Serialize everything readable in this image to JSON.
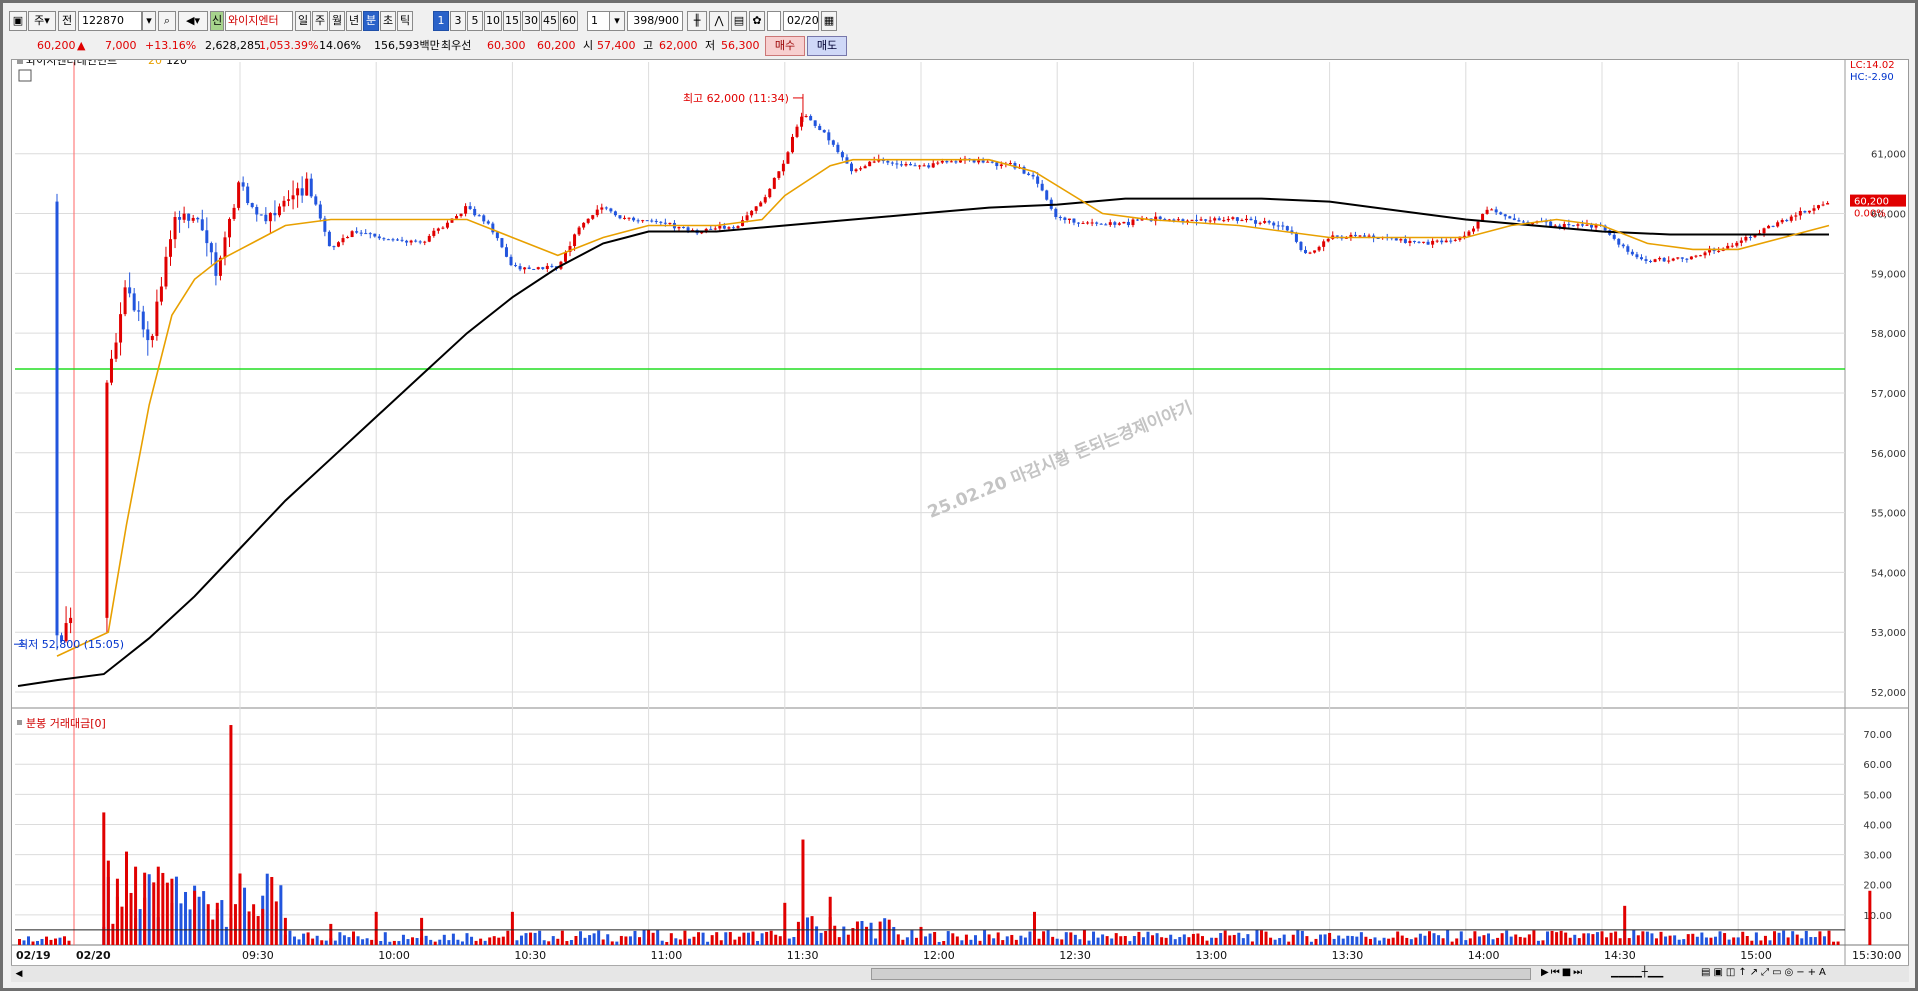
{
  "toolbar": {
    "market_select": "주",
    "prev_label": "전",
    "stock_code": "122870",
    "badge": "신",
    "stock_name": "와이지엔터",
    "period_tabs": [
      "일",
      "주",
      "월",
      "년",
      "분",
      "초",
      "틱"
    ],
    "active_period": "분",
    "interval_buttons": [
      "1",
      "3",
      "5",
      "10",
      "15",
      "30",
      "45",
      "60"
    ],
    "active_interval": "1",
    "interval_select": "1",
    "count_display": "398/900",
    "date_value": "02/20"
  },
  "infobar": {
    "price": "60,200",
    "change_arrow": "▲",
    "change": "7,000",
    "change_pct": "+13.16%",
    "volume": "2,628,285",
    "volume_ratio": "1,053.39%",
    "turnover": "14.06%",
    "amount": "156,593백만",
    "best_label": "최우선",
    "best_ask": "60,300",
    "best_bid": "60,200",
    "open_label": "시",
    "open": "57,400",
    "high_label": "고",
    "high": "62,000",
    "low_label": "저",
    "low": "56,300",
    "buy_button": "매수",
    "sell_button": "매도"
  },
  "colors": {
    "up": "#e00000",
    "down": "#2255dd",
    "ma20": "#e8a000",
    "ma120": "#000000",
    "support_line": "#22dd22",
    "grid": "#dcdcdc"
  },
  "price_panel": {
    "legend_name": "와이지엔터테인먼트",
    "legend_ma20": "20",
    "legend_ma120": "120",
    "lc_label": "LC:14.02",
    "hc_label": "HC:-2.90",
    "high_annotation": "최고 62,000 (11:34)",
    "low_annotation": "최저 52,800 (15:05)",
    "current_price_tag": "60,200",
    "current_pct_tag": "0.00%",
    "watermark": "25.02.20 마감시황 돈되는경제이야기",
    "y_ticks": [
      "61,000",
      "60,000",
      "59,000",
      "58,000",
      "57,000",
      "56,000",
      "55,000",
      "54,000",
      "53,000",
      "52,000"
    ]
  },
  "volume_panel": {
    "legend": "분봉 거래대금[0]",
    "y_ticks": [
      "70.00",
      "60.00",
      "50.00",
      "40.00",
      "30.00",
      "20.00",
      "10.00"
    ]
  },
  "x_axis": {
    "labels": [
      "02/19",
      "02/20",
      "09:30",
      "10:00",
      "10:30",
      "11:00",
      "11:30",
      "12:00",
      "12:30",
      "13:00",
      "13:30",
      "14:00",
      "14:30",
      "15:00",
      "15:30:00"
    ]
  },
  "chart_data": {
    "type": "candlestick",
    "symbol": "와이지엔터테인먼트",
    "interval": "1분",
    "ylim": [
      51900,
      62400
    ],
    "volume_ylim": [
      0,
      76
    ],
    "support_level": 57400,
    "high": {
      "value": 62000,
      "time": "11:34"
    },
    "low": {
      "value": 52800,
      "time": "15:05"
    },
    "close_path": {
      "x": [
        "15:05",
        "15:30",
        "09:00",
        "09:01",
        "09:05",
        "09:10",
        "09:15",
        "09:20",
        "09:25",
        "09:30",
        "09:35",
        "09:40",
        "09:45",
        "09:50",
        "09:55",
        "10:00",
        "10:10",
        "10:20",
        "10:25",
        "10:30",
        "10:40",
        "10:45",
        "10:50",
        "10:55",
        "11:00",
        "11:10",
        "11:20",
        "11:25",
        "11:30",
        "11:34",
        "11:40",
        "11:45",
        "11:50",
        "12:00",
        "12:10",
        "12:20",
        "12:25",
        "12:30",
        "12:40",
        "12:50",
        "13:00",
        "13:10",
        "13:20",
        "13:25",
        "13:30",
        "13:40",
        "13:50",
        "14:00",
        "14:05",
        "14:10",
        "14:20",
        "14:30",
        "14:35",
        "14:40",
        "14:50",
        "15:00",
        "15:10",
        "15:20"
      ],
      "y": [
        52850,
        53200,
        56700,
        57400,
        58800,
        57800,
        59800,
        60000,
        59000,
        60500,
        59800,
        60300,
        60500,
        59400,
        59700,
        59600,
        59500,
        60100,
        59800,
        59100,
        59100,
        59800,
        60100,
        59900,
        59900,
        59700,
        59800,
        60200,
        60900,
        61700,
        61200,
        60700,
        60900,
        60800,
        60900,
        60800,
        60600,
        59900,
        59800,
        59900,
        59900,
        59900,
        59800,
        59300,
        59600,
        59600,
        59500,
        59600,
        60100,
        59900,
        59800,
        59800,
        59400,
        59200,
        59300,
        59500,
        59900,
        60200
      ]
    },
    "ma20": {
      "x": [
        "15:05",
        "09:01",
        "09:05",
        "09:10",
        "09:15",
        "09:20",
        "09:25",
        "09:30",
        "09:35",
        "09:40",
        "09:50",
        "10:00",
        "10:15",
        "10:20",
        "10:30",
        "10:40",
        "10:50",
        "11:00",
        "11:15",
        "11:25",
        "11:30",
        "11:40",
        "11:45",
        "11:50",
        "12:00",
        "12:15",
        "12:25",
        "12:40",
        "12:50",
        "13:10",
        "13:30",
        "13:40",
        "14:00",
        "14:10",
        "14:20",
        "14:30",
        "14:40",
        "14:50",
        "15:00",
        "15:10",
        "15:20"
      ],
      "y": [
        52600,
        53000,
        54800,
        56800,
        58300,
        58900,
        59200,
        59400,
        59600,
        59800,
        59900,
        59900,
        59900,
        59900,
        59600,
        59300,
        59600,
        59800,
        59800,
        59900,
        60300,
        60800,
        60900,
        60900,
        60900,
        60900,
        60700,
        60000,
        59900,
        59800,
        59600,
        59600,
        59600,
        59800,
        59900,
        59800,
        59500,
        59400,
        59400,
        59600,
        59800
      ]
    },
    "ma120": {
      "x": [
        "14:00",
        "15:05",
        "09:00",
        "09:10",
        "09:20",
        "09:30",
        "09:40",
        "09:50",
        "10:00",
        "10:10",
        "10:20",
        "10:30",
        "10:40",
        "10:50",
        "10:55",
        "11:00",
        "11:15",
        "11:30",
        "11:45",
        "12:00",
        "12:15",
        "12:30",
        "12:45",
        "13:00",
        "13:15",
        "13:30",
        "13:45",
        "14:00",
        "14:15",
        "14:30",
        "14:45",
        "15:00",
        "15:20"
      ],
      "y": [
        52100,
        52200,
        52300,
        52900,
        53600,
        54400,
        55200,
        55900,
        56600,
        57300,
        58000,
        58600,
        59100,
        59500,
        59600,
        59700,
        59700,
        59800,
        59900,
        60000,
        60100,
        60150,
        60250,
        60250,
        60250,
        60200,
        60050,
        59900,
        59800,
        59700,
        59650,
        59650,
        59650
      ]
    },
    "volume": {
      "x": [
        "09:00",
        "09:01",
        "09:03",
        "09:05",
        "09:07",
        "09:09",
        "09:12",
        "09:15",
        "09:20",
        "09:25",
        "09:28",
        "09:30",
        "09:35",
        "09:40",
        "09:50",
        "10:00",
        "10:10",
        "10:30",
        "11:00",
        "11:30",
        "11:34",
        "11:40",
        "12:00",
        "12:25",
        "13:30",
        "14:35",
        "15:29"
      ],
      "y": [
        44,
        28,
        22,
        31,
        26,
        24,
        26,
        22,
        18,
        14,
        73,
        16,
        12,
        9,
        7,
        11,
        9,
        11,
        5,
        14,
        35,
        16,
        6,
        11,
        4,
        13,
        18
      ]
    }
  }
}
